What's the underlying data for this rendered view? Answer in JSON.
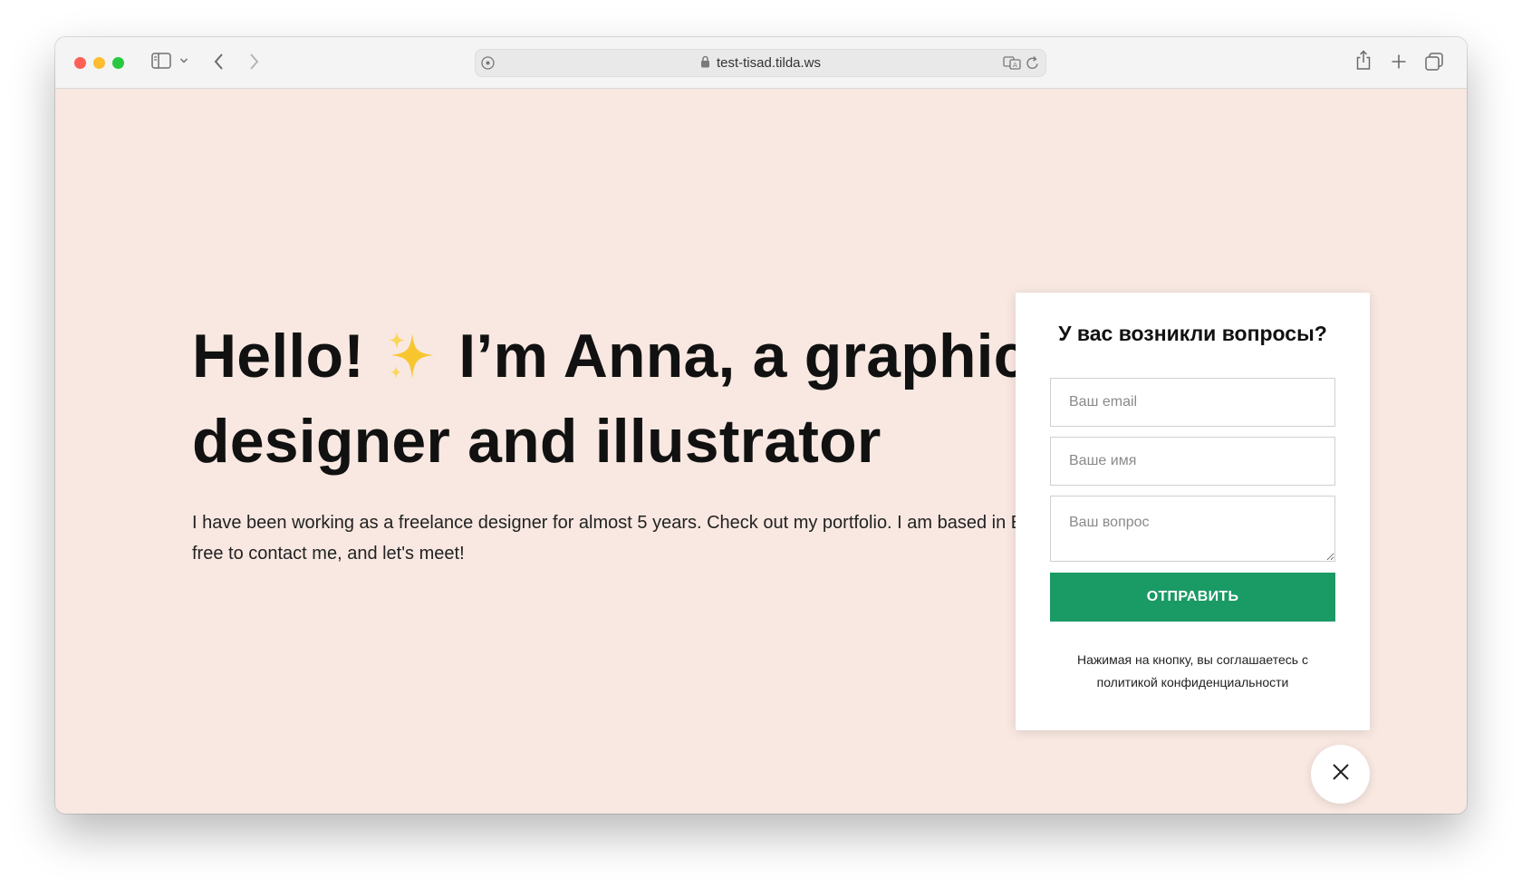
{
  "browser": {
    "url": "test-tisad.tilda.ws"
  },
  "hero": {
    "title_line1_before": "Hello!",
    "title_emoji": "✨",
    "title_line1_after": "I’m Anna, a graphic",
    "title_line2": "designer and illustrator",
    "text_line1": "I have been working as a freelance designer for almost 5 years. Check out my portfolio. I am based in Bar",
    "text_line2": "free to contact me, and let's meet!"
  },
  "form": {
    "title": "У вас возникли вопросы?",
    "email_placeholder": "Ваш email",
    "name_placeholder": "Ваше имя",
    "question_placeholder": "Ваш вопрос",
    "submit_label": "ОТПРАВИТЬ",
    "consent_line1": "Нажимая на кнопку, вы соглашаетесь с",
    "consent_line2": "политикой конфиденциальности"
  },
  "colors": {
    "page_background": "#f8e8e1",
    "submit_button": "#1a9a65"
  },
  "icons": {
    "sidebar": "sidebar-icon",
    "back": "chevron-left-icon",
    "forward": "chevron-right-icon",
    "share": "share-icon",
    "new_tab": "plus-icon",
    "tabs": "tab-overview-icon",
    "close": "close-icon"
  }
}
